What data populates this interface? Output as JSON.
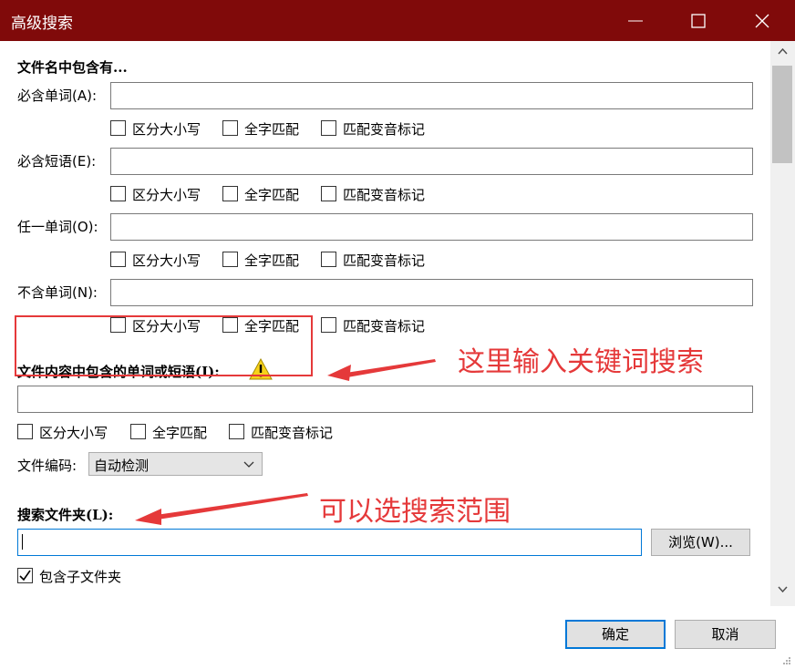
{
  "window": {
    "title": "高级搜索",
    "minimize_icon": "minimize-icon",
    "maximize_icon": "maximize-icon",
    "close_icon": "close-icon"
  },
  "filename_section": {
    "heading": "文件名中包含有...",
    "rows": [
      {
        "label": "必含单词(A):",
        "value": ""
      },
      {
        "label": "必含短语(E):",
        "value": ""
      },
      {
        "label": "任一单词(O):",
        "value": ""
      },
      {
        "label": "不含单词(N):",
        "value": ""
      }
    ],
    "options": {
      "case": "区分大小写",
      "whole": "全字匹配",
      "diacritics": "匹配变音标记"
    }
  },
  "content_section": {
    "heading": "文件内容中包含的单词或短语(I):",
    "value": "",
    "warning_icon": "warning-icon",
    "options": {
      "case": "区分大小写",
      "whole": "全字匹配",
      "diacritics": "匹配变音标记"
    },
    "encoding_label": "文件编码:",
    "encoding_value": "自动检测"
  },
  "folder_section": {
    "heading": "搜索文件夹(L):",
    "value": "",
    "browse_label": "浏览(W)...",
    "include_subfolders_label": "包含子文件夹",
    "include_subfolders_checked": true
  },
  "footer": {
    "ok_label": "确定",
    "cancel_label": "取消"
  },
  "annotations": {
    "content_hint": "这里输入关键词搜索",
    "folder_hint": "可以选搜索范围"
  },
  "colors": {
    "titlebar": "#800a0a",
    "annotation": "#e5393a",
    "focus": "#0078d7"
  }
}
